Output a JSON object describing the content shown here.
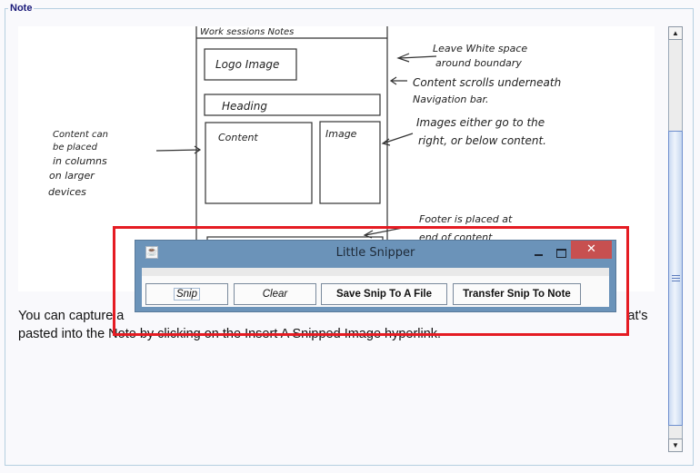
{
  "panel": {
    "legend": "Note"
  },
  "sketch": {
    "wireframe_title": "Work sessions   Notes",
    "boxes": {
      "logo": "Logo Image",
      "heading": "Heading",
      "content": "Content",
      "image": "Image"
    },
    "annotations": {
      "whitespace_line1": "Leave White space",
      "whitespace_line2": "around boundary",
      "scroll_line1": "Content scrolls underneath",
      "scroll_line2": "Navigation bar.",
      "images_line1": "Images either go to the",
      "images_line2": "right, or below content.",
      "columns_line1": "Content can",
      "columns_line2": "be placed",
      "columns_line3": "in columns",
      "columns_line4": "on larger",
      "columns_line5": "devices",
      "footer_line1": "Footer is placed at",
      "footer_line2": "end of content"
    }
  },
  "note_body": {
    "text": "You can capture any image on the display region you want into the Note by snipping it — an image that's pasted into the Note by clicking on the Insert A Snipped Image hyperlink.",
    "visible_line1_start": "You can capture a",
    "visible_line1_end": "at's",
    "visible_line2": "pasted into the Note by clicking on the Insert A Snipped Image hyperlink."
  },
  "snipper_window": {
    "title": "Little Snipper",
    "app_icon": "java-cup-icon",
    "controls": {
      "minimize": "minimize",
      "maximize": "maximize",
      "close_glyph": "✕"
    },
    "buttons": {
      "snip": "Snip",
      "clear": "Clear",
      "save": "Save Snip To A File",
      "transfer": "Transfer Snip To Note"
    }
  },
  "scrollbar": {
    "up_glyph": "▲",
    "down_glyph": "▼",
    "thumb_position_fraction": 0.28,
    "thumb_size_fraction": 0.73
  },
  "colors": {
    "legend_text": "#1a1a7a",
    "frame_border": "#b5cfe0",
    "highlight": "#e51c23",
    "window_chrome": "#6b93b9",
    "close_button": "#c75050"
  }
}
